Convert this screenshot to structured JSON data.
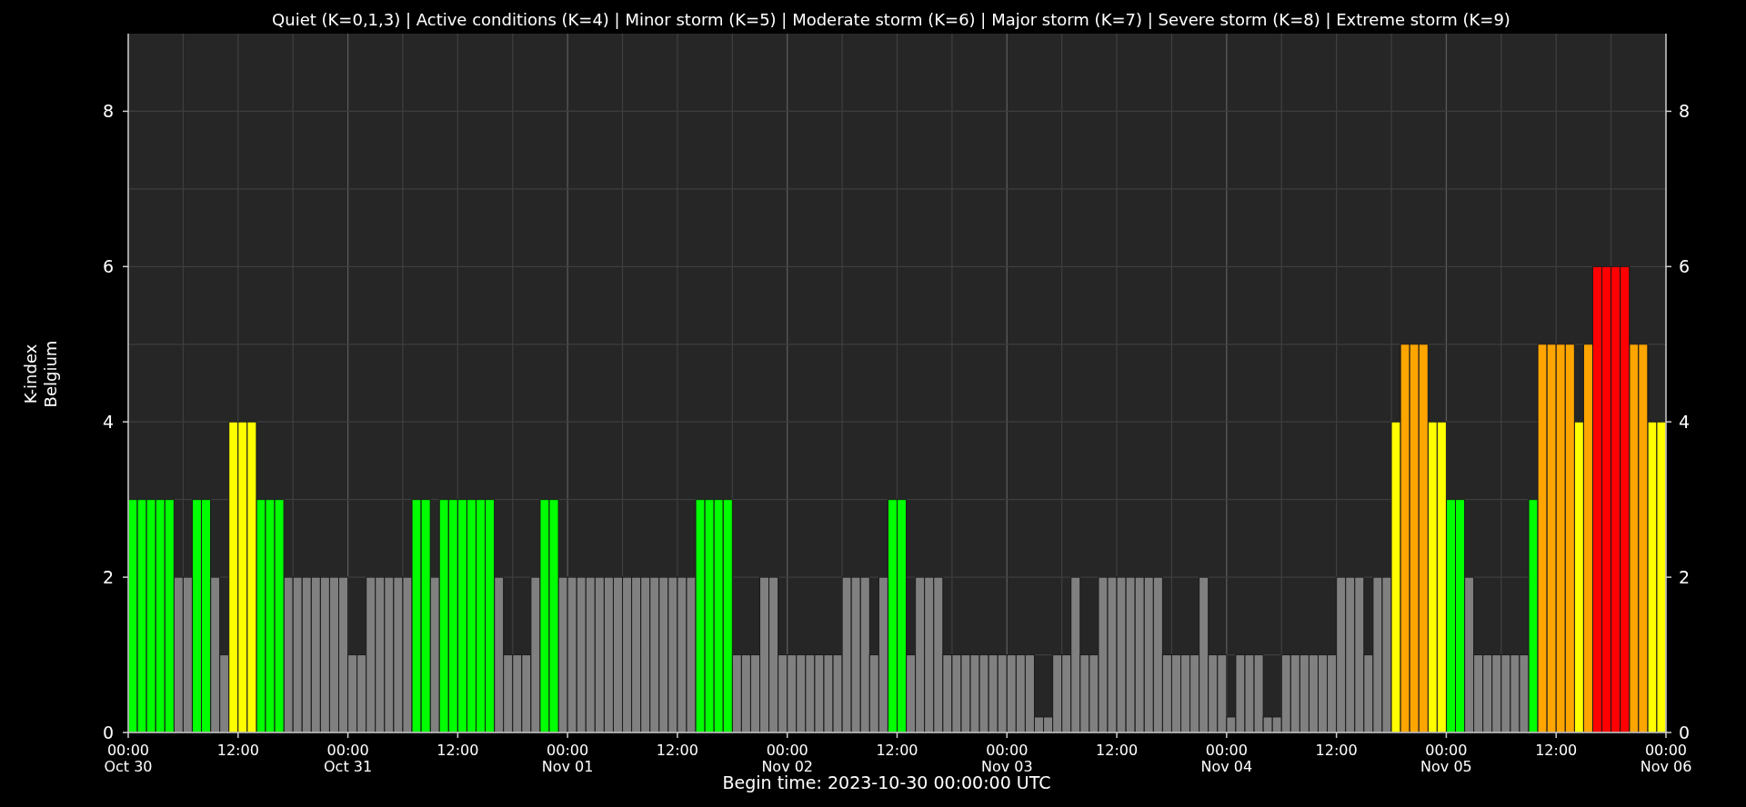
{
  "title": "Quiet (K=0,1,3) | Active conditions (K=4) | Minor storm (K=5) | Moderate storm (K=6) | Major storm (K=7) | Severe storm (K=8) | Extreme storm (K=9)",
  "chart": {
    "right_axis_labels": [
      "8",
      "6",
      "4",
      "2",
      "0"
    ],
    "chart_data": {
      "type": "bar",
      "xlabel": "Begin time: 2023-10-30 00:00:00 UTC",
      "ylabel": "K-index\nBelgium",
      "grid": true,
      "x": [
        "2023-10-30T00:00",
        "2023-10-30T01:00",
        "2023-10-30T02:00",
        "2023-10-30T03:00",
        "2023-10-30T04:00",
        "2023-10-30T05:00",
        "2023-10-30T06:00",
        "2023-10-30T07:00",
        "2023-10-30T08:00",
        "2023-10-30T09:00",
        "2023-10-30T10:00",
        "2023-10-30T11:00",
        "2023-10-30T12:00",
        "2023-10-30T13:00",
        "2023-10-30T14:00",
        "2023-10-30T15:00",
        "2023-10-30T16:00",
        "2023-10-30T17:00",
        "2023-10-30T18:00",
        "2023-10-30T19:00",
        "2023-10-30T20:00",
        "2023-10-30T21:00",
        "2023-10-30T22:00",
        "2023-10-30T23:00",
        "2023-10-31T00:00",
        "2023-10-31T01:00",
        "2023-10-31T02:00",
        "2023-10-31T03:00",
        "2023-10-31T04:00",
        "2023-10-31T05:00",
        "2023-10-31T06:00",
        "2023-10-31T07:00",
        "2023-10-31T08:00",
        "2023-10-31T09:00",
        "2023-10-31T10:00",
        "2023-10-31T11:00",
        "2023-10-31T12:00",
        "2023-10-31T13:00",
        "2023-10-31T14:00",
        "2023-10-31T15:00",
        "2023-10-31T16:00",
        "2023-10-31T17:00",
        "2023-10-31T18:00",
        "2023-10-31T19:00",
        "2023-10-31T20:00",
        "2023-10-31T21:00",
        "2023-10-31T22:00",
        "2023-10-31T23:00",
        "2023-11-01T00:00",
        "2023-11-01T01:00",
        "2023-11-01T02:00",
        "2023-11-01T03:00",
        "2023-11-01T04:00",
        "2023-11-01T05:00",
        "2023-11-01T06:00",
        "2023-11-01T07:00",
        "2023-11-01T08:00",
        "2023-11-01T09:00",
        "2023-11-01T10:00",
        "2023-11-01T11:00",
        "2023-11-01T12:00",
        "2023-11-01T13:00",
        "2023-11-01T14:00",
        "2023-11-01T15:00",
        "2023-11-01T16:00",
        "2023-11-01T17:00",
        "2023-11-01T18:00",
        "2023-11-01T19:00",
        "2023-11-01T20:00",
        "2023-11-01T21:00",
        "2023-11-01T22:00",
        "2023-11-01T23:00",
        "2023-11-02T00:00",
        "2023-11-02T01:00",
        "2023-11-02T02:00",
        "2023-11-02T03:00",
        "2023-11-02T04:00",
        "2023-11-02T05:00",
        "2023-11-02T06:00",
        "2023-11-02T07:00",
        "2023-11-02T08:00",
        "2023-11-02T09:00",
        "2023-11-02T10:00",
        "2023-11-02T11:00",
        "2023-11-02T12:00",
        "2023-11-02T13:00",
        "2023-11-02T14:00",
        "2023-11-02T15:00",
        "2023-11-02T16:00",
        "2023-11-02T17:00",
        "2023-11-02T18:00",
        "2023-11-02T19:00",
        "2023-11-02T20:00",
        "2023-11-02T21:00",
        "2023-11-02T22:00",
        "2023-11-02T23:00",
        "2023-11-03T00:00",
        "2023-11-03T01:00",
        "2023-11-03T02:00",
        "2023-11-03T03:00",
        "2023-11-03T04:00",
        "2023-11-03T05:00",
        "2023-11-03T06:00",
        "2023-11-03T07:00",
        "2023-11-03T08:00",
        "2023-11-03T09:00",
        "2023-11-03T10:00",
        "2023-11-03T11:00",
        "2023-11-03T12:00",
        "2023-11-03T13:00",
        "2023-11-03T14:00",
        "2023-11-03T15:00",
        "2023-11-03T16:00",
        "2023-11-03T17:00",
        "2023-11-03T18:00",
        "2023-11-03T19:00",
        "2023-11-03T20:00",
        "2023-11-03T21:00",
        "2023-11-03T22:00",
        "2023-11-03T23:00",
        "2023-11-04T00:00",
        "2023-11-04T01:00",
        "2023-11-04T02:00",
        "2023-11-04T03:00",
        "2023-11-04T04:00",
        "2023-11-04T05:00",
        "2023-11-04T06:00",
        "2023-11-04T07:00",
        "2023-11-04T08:00",
        "2023-11-04T09:00",
        "2023-11-04T10:00",
        "2023-11-04T11:00",
        "2023-11-04T12:00",
        "2023-11-04T13:00",
        "2023-11-04T14:00",
        "2023-11-04T15:00",
        "2023-11-04T16:00",
        "2023-11-04T17:00",
        "2023-11-04T18:00",
        "2023-11-04T19:00",
        "2023-11-04T20:00",
        "2023-11-04T21:00",
        "2023-11-04T22:00",
        "2023-11-04T23:00",
        "2023-11-05T00:00",
        "2023-11-05T01:00",
        "2023-11-05T02:00",
        "2023-11-05T03:00",
        "2023-11-05T04:00",
        "2023-11-05T05:00",
        "2023-11-05T06:00",
        "2023-11-05T07:00",
        "2023-11-05T08:00",
        "2023-11-05T09:00",
        "2023-11-05T10:00",
        "2023-11-05T11:00",
        "2023-11-05T12:00",
        "2023-11-05T13:00",
        "2023-11-05T14:00",
        "2023-11-05T15:00",
        "2023-11-05T16:00",
        "2023-11-05T17:00",
        "2023-11-05T18:00",
        "2023-11-05T19:00",
        "2023-11-05T20:00",
        "2023-11-05T21:00",
        "2023-11-05T22:00",
        "2023-11-05T23:00"
      ],
      "xlim": [
        "2023-10-30T00:00",
        "2023-11-06T00:00"
      ],
      "ylim": [
        0,
        9
      ],
      "xticks": [
        {
          "value": "2023-10-30T00:00",
          "label": "00:00\nOct 30"
        },
        {
          "value": "2023-10-30T12:00",
          "label": "12:00"
        },
        {
          "value": "2023-10-31T00:00",
          "label": "00:00\nOct 31"
        },
        {
          "value": "2023-10-31T12:00",
          "label": "12:00"
        },
        {
          "value": "2023-11-01T00:00",
          "label": "00:00\nNov 01"
        },
        {
          "value": "2023-11-01T12:00",
          "label": "12:00"
        },
        {
          "value": "2023-11-02T00:00",
          "label": "00:00\nNov 02"
        },
        {
          "value": "2023-11-02T12:00",
          "label": "12:00"
        },
        {
          "value": "2023-11-03T00:00",
          "label": "00:00\nNov 03"
        },
        {
          "value": "2023-11-03T12:00",
          "label": "12:00"
        },
        {
          "value": "2023-11-04T00:00",
          "label": "00:00\nNov 04"
        },
        {
          "value": "2023-11-04T12:00",
          "label": "12:00"
        },
        {
          "value": "2023-11-05T00:00",
          "label": "00:00\nNov 05"
        },
        {
          "value": "2023-11-05T12:00",
          "label": "12:00"
        },
        {
          "value": "2023-11-06T00:00",
          "label": "00:00\nNov 06"
        }
      ],
      "yticks": [
        {
          "value": 0,
          "label": "0"
        },
        {
          "value": 2,
          "label": "2"
        },
        {
          "value": 4,
          "label": "4"
        },
        {
          "value": 6,
          "label": "6"
        },
        {
          "value": 8,
          "label": "8"
        }
      ],
      "series": [
        {
          "color": "#808080",
          "values": [
            null,
            null,
            null,
            null,
            null,
            2,
            2,
            null,
            null,
            2,
            1,
            null,
            null,
            null,
            null,
            null,
            null,
            2,
            2,
            2,
            2,
            2,
            2,
            2,
            1,
            1,
            2,
            2,
            2,
            2,
            2,
            null,
            null,
            2,
            null,
            null,
            null,
            null,
            null,
            null,
            2,
            1,
            1,
            1,
            2,
            null,
            null,
            2,
            2,
            2,
            2,
            2,
            2,
            2,
            2,
            2,
            2,
            2,
            2,
            2,
            2,
            2,
            null,
            null,
            null,
            null,
            1,
            1,
            1,
            2,
            2,
            1,
            1,
            1,
            1,
            1,
            1,
            1,
            2,
            2,
            2,
            1,
            2,
            null,
            null,
            1,
            2,
            2,
            2,
            1,
            1,
            1,
            1,
            1,
            1,
            1,
            1,
            1,
            1,
            0.2,
            0.2,
            1,
            1,
            2,
            1,
            1,
            2,
            2,
            2,
            2,
            2,
            2,
            2,
            1,
            1,
            1,
            1,
            2,
            1,
            1,
            0.2,
            1,
            1,
            1,
            0.2,
            0.2,
            1,
            1,
            1,
            1,
            1,
            1,
            2,
            2,
            2,
            1,
            2,
            2,
            null,
            null,
            null,
            null,
            null,
            null,
            null,
            null,
            2,
            1,
            1,
            1,
            1,
            1,
            1,
            null,
            null,
            null,
            null,
            null,
            null,
            null,
            null,
            null,
            null,
            null,
            null,
            null,
            null,
            null
          ]
        },
        {
          "color": "#00ff00",
          "values": [
            3,
            3,
            3,
            3,
            3,
            null,
            null,
            3,
            3,
            null,
            null,
            null,
            null,
            null,
            3,
            3,
            3,
            null,
            null,
            null,
            null,
            null,
            null,
            null,
            null,
            null,
            null,
            null,
            null,
            null,
            null,
            3,
            3,
            null,
            3,
            3,
            3,
            3,
            3,
            3,
            null,
            null,
            null,
            null,
            null,
            3,
            3,
            null,
            null,
            null,
            null,
            null,
            null,
            null,
            null,
            null,
            null,
            null,
            null,
            null,
            null,
            null,
            3,
            3,
            3,
            3,
            null,
            null,
            null,
            null,
            null,
            null,
            null,
            null,
            null,
            null,
            null,
            null,
            null,
            null,
            null,
            null,
            null,
            3,
            3,
            null,
            null,
            null,
            null,
            null,
            null,
            null,
            null,
            null,
            null,
            null,
            null,
            null,
            null,
            null,
            null,
            null,
            null,
            null,
            null,
            null,
            null,
            null,
            null,
            null,
            null,
            null,
            null,
            null,
            null,
            null,
            null,
            null,
            null,
            null,
            null,
            null,
            null,
            null,
            null,
            null,
            null,
            null,
            null,
            null,
            null,
            null,
            null,
            null,
            null,
            null,
            null,
            null,
            null,
            null,
            null,
            null,
            null,
            null,
            3,
            3,
            null,
            null,
            null,
            null,
            null,
            null,
            null,
            3,
            null,
            null,
            null,
            null,
            null,
            null,
            null,
            null,
            null,
            null,
            null,
            null,
            null,
            null
          ]
        },
        {
          "color": "#ffff00",
          "values": [
            null,
            null,
            null,
            null,
            null,
            null,
            null,
            null,
            null,
            null,
            null,
            4,
            4,
            4,
            null,
            null,
            null,
            null,
            null,
            null,
            null,
            null,
            null,
            null,
            null,
            null,
            null,
            null,
            null,
            null,
            null,
            null,
            null,
            null,
            null,
            null,
            null,
            null,
            null,
            null,
            null,
            null,
            null,
            null,
            null,
            null,
            null,
            null,
            null,
            null,
            null,
            null,
            null,
            null,
            null,
            null,
            null,
            null,
            null,
            null,
            null,
            null,
            null,
            null,
            null,
            null,
            null,
            null,
            null,
            null,
            null,
            null,
            null,
            null,
            null,
            null,
            null,
            null,
            null,
            null,
            null,
            null,
            null,
            null,
            null,
            null,
            null,
            null,
            null,
            null,
            null,
            null,
            null,
            null,
            null,
            null,
            null,
            null,
            null,
            null,
            null,
            null,
            null,
            null,
            null,
            null,
            null,
            null,
            null,
            null,
            null,
            null,
            null,
            null,
            null,
            null,
            null,
            null,
            null,
            null,
            null,
            null,
            null,
            null,
            null,
            null,
            null,
            null,
            null,
            null,
            null,
            null,
            null,
            null,
            null,
            null,
            null,
            null,
            4,
            null,
            null,
            null,
            4,
            4,
            null,
            null,
            null,
            null,
            null,
            null,
            null,
            null,
            null,
            null,
            null,
            null,
            null,
            null,
            4,
            null,
            null,
            null,
            null,
            null,
            null,
            null,
            4,
            4
          ]
        },
        {
          "color": "#ffa500",
          "values": [
            null,
            null,
            null,
            null,
            null,
            null,
            null,
            null,
            null,
            null,
            null,
            null,
            null,
            null,
            null,
            null,
            null,
            null,
            null,
            null,
            null,
            null,
            null,
            null,
            null,
            null,
            null,
            null,
            null,
            null,
            null,
            null,
            null,
            null,
            null,
            null,
            null,
            null,
            null,
            null,
            null,
            null,
            null,
            null,
            null,
            null,
            null,
            null,
            null,
            null,
            null,
            null,
            null,
            null,
            null,
            null,
            null,
            null,
            null,
            null,
            null,
            null,
            null,
            null,
            null,
            null,
            null,
            null,
            null,
            null,
            null,
            null,
            null,
            null,
            null,
            null,
            null,
            null,
            null,
            null,
            null,
            null,
            null,
            null,
            null,
            null,
            null,
            null,
            null,
            null,
            null,
            null,
            null,
            null,
            null,
            null,
            null,
            null,
            null,
            null,
            null,
            null,
            null,
            null,
            null,
            null,
            null,
            null,
            null,
            null,
            null,
            null,
            null,
            null,
            null,
            null,
            null,
            null,
            null,
            null,
            null,
            null,
            null,
            null,
            null,
            null,
            null,
            null,
            null,
            null,
            null,
            null,
            null,
            null,
            null,
            null,
            null,
            null,
            null,
            5,
            5,
            5,
            null,
            null,
            null,
            null,
            null,
            null,
            null,
            null,
            null,
            null,
            null,
            null,
            5,
            5,
            5,
            5,
            null,
            5,
            null,
            null,
            null,
            null,
            5,
            5,
            null,
            null
          ]
        },
        {
          "color": "#ff0000",
          "values": [
            null,
            null,
            null,
            null,
            null,
            null,
            null,
            null,
            null,
            null,
            null,
            null,
            null,
            null,
            null,
            null,
            null,
            null,
            null,
            null,
            null,
            null,
            null,
            null,
            null,
            null,
            null,
            null,
            null,
            null,
            null,
            null,
            null,
            null,
            null,
            null,
            null,
            null,
            null,
            null,
            null,
            null,
            null,
            null,
            null,
            null,
            null,
            null,
            null,
            null,
            null,
            null,
            null,
            null,
            null,
            null,
            null,
            null,
            null,
            null,
            null,
            null,
            null,
            null,
            null,
            null,
            null,
            null,
            null,
            null,
            null,
            null,
            null,
            null,
            null,
            null,
            null,
            null,
            null,
            null,
            null,
            null,
            null,
            null,
            null,
            null,
            null,
            null,
            null,
            null,
            null,
            null,
            null,
            null,
            null,
            null,
            null,
            null,
            null,
            null,
            null,
            null,
            null,
            null,
            null,
            null,
            null,
            null,
            null,
            null,
            null,
            null,
            null,
            null,
            null,
            null,
            null,
            null,
            null,
            null,
            null,
            null,
            null,
            null,
            null,
            null,
            null,
            null,
            null,
            null,
            null,
            null,
            null,
            null,
            null,
            null,
            null,
            null,
            null,
            null,
            null,
            null,
            null,
            null,
            null,
            null,
            null,
            null,
            null,
            null,
            null,
            null,
            null,
            null,
            null,
            null,
            null,
            null,
            null,
            null,
            6,
            6,
            6,
            6,
            null,
            null,
            null,
            null
          ]
        }
      ]
    }
  }
}
